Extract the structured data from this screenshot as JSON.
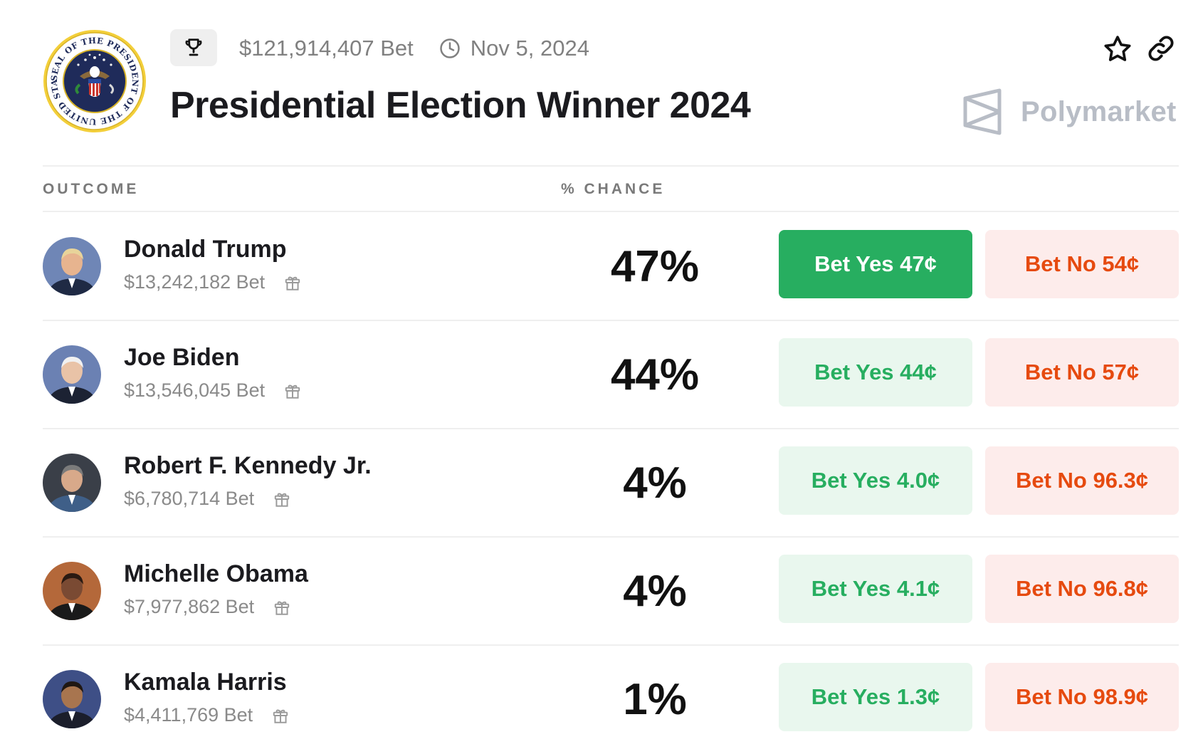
{
  "market": {
    "total_bet": "$121,914,407 Bet",
    "end_date": "Nov 5, 2024",
    "title": "Presidential Election Winner 2024",
    "brand": "Polymarket",
    "seal_text": "SEAL OF THE PRESIDENT OF THE UNITED STATES"
  },
  "table": {
    "col_outcome": "OUTCOME",
    "col_chance": "% CHANCE"
  },
  "outcomes": [
    {
      "name": "Donald Trump",
      "bet": "$13,242,182 Bet",
      "chance": "47%",
      "yes": "Bet Yes 47¢",
      "no": "Bet No 54¢",
      "yes_active": true,
      "suit": "#1f2a44",
      "skin": "#e7b48f",
      "hair": "#e8d49a",
      "bg": "#6f86b6"
    },
    {
      "name": "Joe Biden",
      "bet": "$13,546,045 Bet",
      "chance": "44%",
      "yes": "Bet Yes 44¢",
      "no": "Bet No 57¢",
      "yes_active": false,
      "suit": "#1c2233",
      "skin": "#e9c3a7",
      "hair": "#f1f1f1",
      "bg": "#6b81b3"
    },
    {
      "name": "Robert F. Kennedy Jr.",
      "bet": "$6,780,714 Bet",
      "chance": "4%",
      "yes": "Bet Yes 4.0¢",
      "no": "Bet No 96.3¢",
      "yes_active": false,
      "suit": "#3f5f88",
      "skin": "#d8a98a",
      "hair": "#7b7b7b",
      "bg": "#3a3f48"
    },
    {
      "name": "Michelle Obama",
      "bet": "$7,977,862 Bet",
      "chance": "4%",
      "yes": "Bet Yes 4.1¢",
      "no": "Bet No 96.8¢",
      "yes_active": false,
      "suit": "#1a1a1a",
      "skin": "#7a4a33",
      "hair": "#2a1a12",
      "bg": "#b4683a"
    },
    {
      "name": "Kamala Harris",
      "bet": "$4,411,769 Bet",
      "chance": "1%",
      "yes": "Bet Yes 1.3¢",
      "no": "Bet No 98.9¢",
      "yes_active": false,
      "suit": "#1b1e2b",
      "skin": "#a8754f",
      "hair": "#1f1713",
      "bg": "#3e4f86"
    }
  ]
}
